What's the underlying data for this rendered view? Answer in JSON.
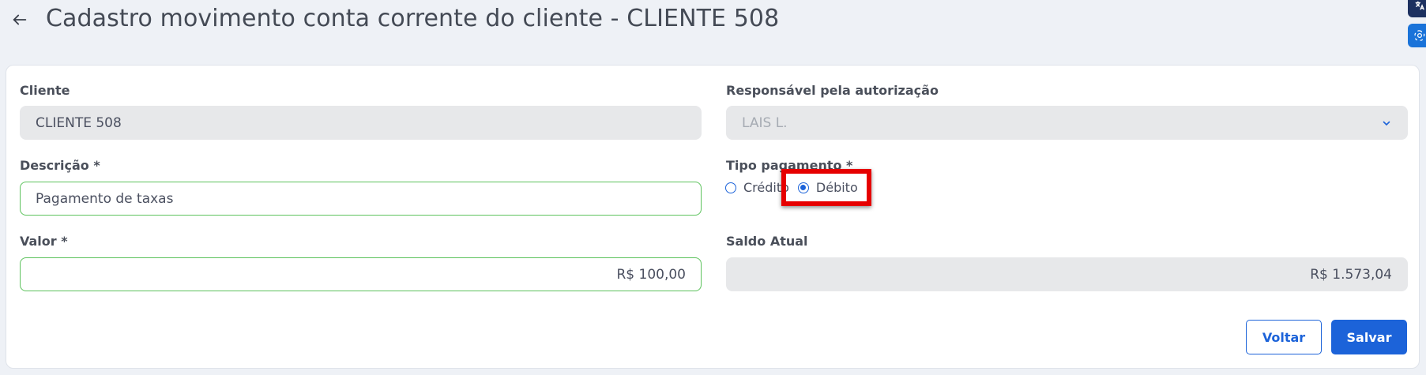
{
  "header": {
    "title": "Cadastro movimento conta corrente do cliente - CLIENTE 508",
    "back_icon": "arrow-left-icon"
  },
  "side_tools": [
    "translate-icon",
    "chatgpt-icon"
  ],
  "form": {
    "cliente": {
      "label": "Cliente",
      "value": "CLIENTE 508"
    },
    "responsavel": {
      "label": "Responsável pela autorização",
      "value": "LAIS L.",
      "icon": "chevron-down-icon"
    },
    "descricao": {
      "label": "Descrição *",
      "value": "Pagamento de taxas"
    },
    "tipo_pagamento": {
      "label": "Tipo pagamento *",
      "options": [
        "Crédito",
        "Débito"
      ],
      "selected": "Débito"
    },
    "valor": {
      "label": "Valor *",
      "value": "R$ 100,00"
    },
    "saldo": {
      "label": "Saldo Atual",
      "value": "R$ 1.573,04"
    }
  },
  "actions": {
    "back_label": "Voltar",
    "save_label": "Salvar"
  },
  "colors": {
    "accent": "#1c63d9",
    "valid_border": "#5cc25c",
    "highlight": "#e60000",
    "background": "#eef1f6"
  }
}
